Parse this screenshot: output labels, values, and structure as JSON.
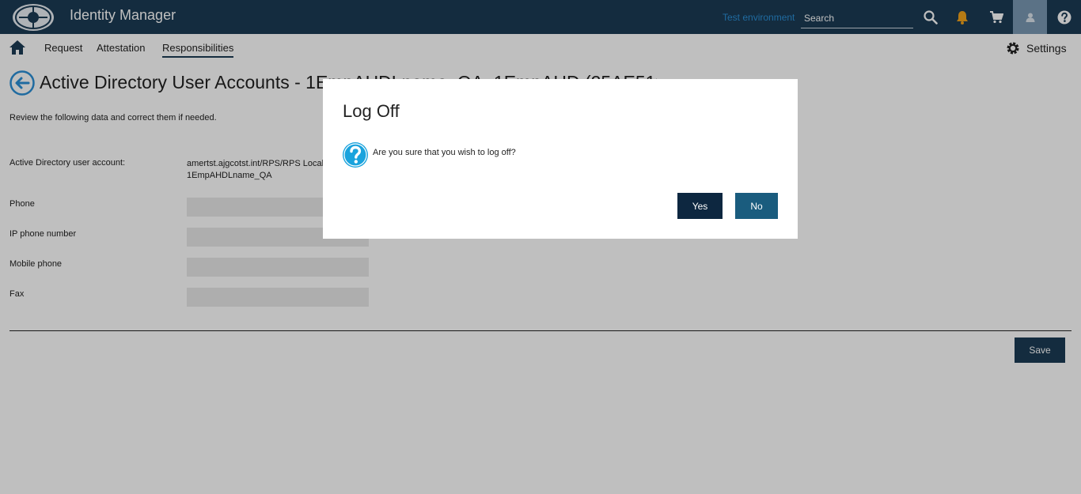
{
  "header": {
    "app_title": "Identity Manager",
    "environment_label": "Test environment",
    "search_placeholder": "Search",
    "accent_color": "#1b3b55",
    "notification_color": "#f2a31b",
    "icons": [
      "logo-icon",
      "search-icon",
      "bell-icon",
      "cart-icon",
      "user-icon",
      "help-icon"
    ]
  },
  "nav": {
    "items": [
      "Request",
      "Attestation",
      "Responsibilities"
    ],
    "active": "Responsibilities",
    "settings_label": "Settings"
  },
  "page": {
    "title": "Active Directory User Accounts - 1EmpAHDLname_QA, 1EmpAHD (25AE519B)",
    "intro": "Review the following data and correct them if needed.",
    "account": {
      "label": "Active Directory user account:",
      "value_line1": "amertst.ajgcotst.int/RPS/RPS Local",
      "value_line2": "1EmpAHDLname_QA"
    },
    "fields": {
      "phone": "Phone",
      "ip_phone": "IP phone number",
      "mobile": "Mobile phone",
      "fax": "Fax"
    },
    "save_label": "Save"
  },
  "dialog": {
    "title": "Log Off",
    "message": "Are you sure that you wish to log off?",
    "yes_label": "Yes",
    "no_label": "No",
    "icon": "question-icon"
  }
}
